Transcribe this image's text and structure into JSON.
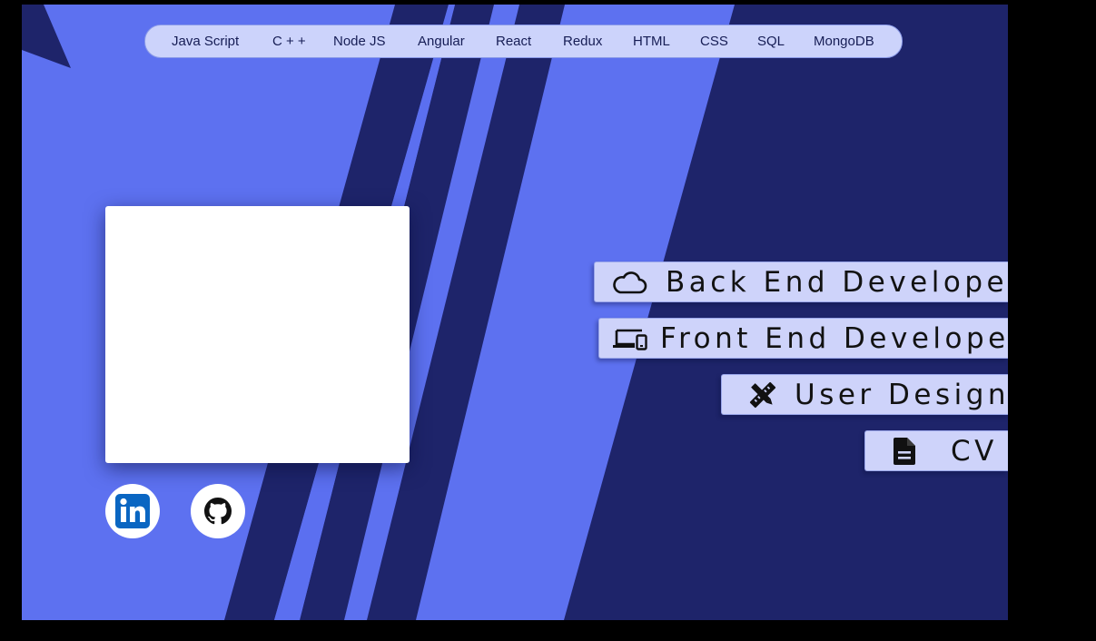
{
  "skills": [
    "Java Script",
    "C + +",
    "Node JS",
    "Angular",
    "React",
    "Redux",
    "HTML",
    "CSS",
    "SQL",
    "MongoDB"
  ],
  "roles": {
    "backend": {
      "label": "Back End Developer",
      "icon": "cloud-icon"
    },
    "frontend": {
      "label": "Front End Developer",
      "icon": "devices-icon"
    },
    "design": {
      "label": "User Design",
      "icon": "design-tools-icon"
    },
    "cv": {
      "label": "CV",
      "icon": "document-icon"
    }
  },
  "social": {
    "linkedin": {
      "icon": "linkedin-icon",
      "text": "in"
    },
    "github": {
      "icon": "github-icon"
    }
  },
  "colors": {
    "background_light": "#5d71f0",
    "background_dark": "#1e246a",
    "tag_fill": "#ced3fa",
    "linkedin_blue": "#0a66c2"
  }
}
